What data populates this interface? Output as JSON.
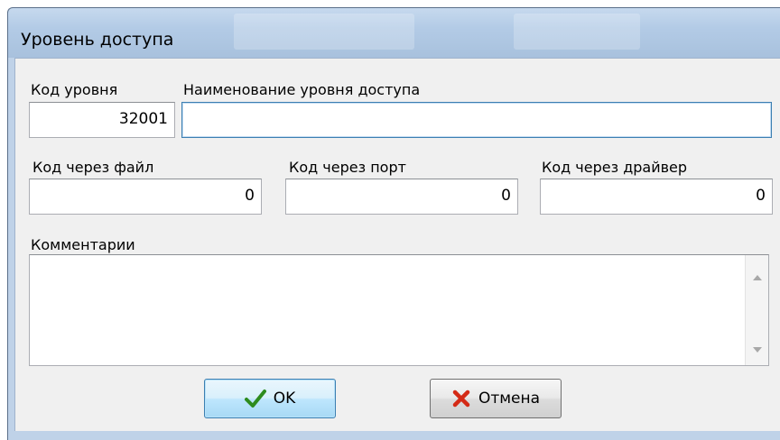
{
  "window": {
    "title": "Уровень доступа"
  },
  "fields": {
    "level_code": {
      "label": "Код уровня",
      "value": "32001"
    },
    "level_name": {
      "label": "Наименование уровня доступа",
      "value": ""
    },
    "file_code": {
      "label": "Код через файл",
      "value": "0"
    },
    "port_code": {
      "label": "Код через порт",
      "value": "0"
    },
    "driver_code": {
      "label": "Код через драйвер",
      "value": "0"
    },
    "comments": {
      "label": "Комментарии",
      "value": ""
    }
  },
  "buttons": {
    "ok": {
      "label": "OK",
      "icon": "checkmark-icon",
      "color": "#2e8b1e"
    },
    "cancel": {
      "label": "Отмена",
      "icon": "red-x-icon",
      "color": "#d42a16"
    }
  }
}
